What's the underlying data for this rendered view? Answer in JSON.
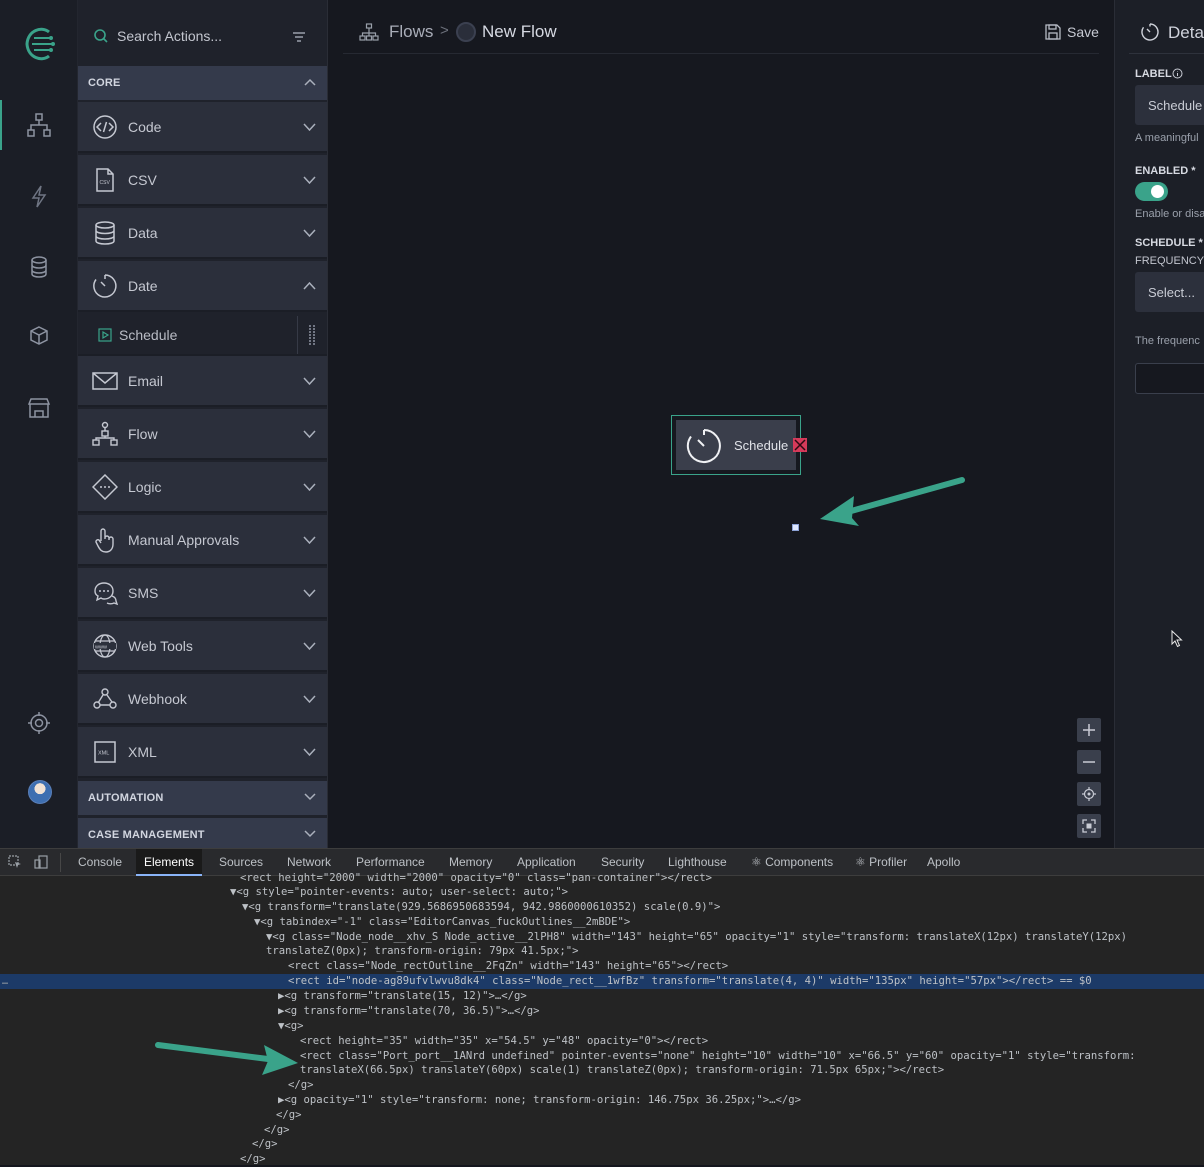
{
  "colors": {
    "accent": "#3aa38a",
    "danger": "#d53a5a",
    "selection": "#1c3a67"
  },
  "sidebar_rail": {
    "icons": [
      "logo-icon",
      "flows-icon",
      "lightning-icon",
      "database-icon",
      "cubes-icon",
      "store-icon",
      "settings-icon",
      "avatar"
    ]
  },
  "actions_panel": {
    "search_placeholder": "Search Actions...",
    "sections": [
      {
        "label": "CORE",
        "expanded": true,
        "items": [
          {
            "label": "Code",
            "icon": "code-icon"
          },
          {
            "label": "CSV",
            "icon": "csv-file-icon"
          },
          {
            "label": "Data",
            "icon": "database-icon"
          },
          {
            "label": "Date",
            "icon": "timer-icon",
            "expanded": true,
            "children": [
              {
                "label": "Schedule",
                "icon": "play-square-icon"
              }
            ]
          },
          {
            "label": "Email",
            "icon": "envelope-icon"
          },
          {
            "label": "Flow",
            "icon": "flow-tree-icon"
          },
          {
            "label": "Logic",
            "icon": "diamond-icon"
          },
          {
            "label": "Manual Approvals",
            "icon": "hand-pointer-icon"
          },
          {
            "label": "SMS",
            "icon": "chat-bubbles-icon"
          },
          {
            "label": "Web Tools",
            "icon": "globe-www-icon"
          },
          {
            "label": "Webhook",
            "icon": "webhook-icon"
          },
          {
            "label": "XML",
            "icon": "xml-file-icon"
          }
        ]
      },
      {
        "label": "AUTOMATION",
        "expanded": false
      },
      {
        "label": "CASE MANAGEMENT",
        "expanded": false
      }
    ]
  },
  "canvas": {
    "breadcrumb": {
      "root": "Flows",
      "separator": ">",
      "current": "New Flow"
    },
    "save_label": "Save",
    "node": {
      "label": "Schedule"
    },
    "zoom_controls": [
      "zoom-in",
      "zoom-out",
      "center",
      "fit"
    ]
  },
  "details": {
    "title": "Detai",
    "label_heading": "LABEL",
    "label_value": "Schedule",
    "label_help": "A meaningful",
    "enabled_heading": "ENABLED *",
    "enabled": true,
    "enabled_help": "Enable or disa",
    "schedule_heading": "SCHEDULE *",
    "frequency_heading": "FREQUENCY",
    "frequency_placeholder": "Select...",
    "frequency_help": "The frequenc"
  },
  "devtools": {
    "tabs": [
      "Console",
      "Elements",
      "Sources",
      "Network",
      "Performance",
      "Memory",
      "Application",
      "Security",
      "Lighthouse",
      "⚛ Components",
      "⚛ Profiler",
      "Apollo"
    ],
    "active_tab": "Elements",
    "lines": [
      "<rect height=\"2000\" width=\"2000\" opacity=\"0\" class=\"pan-container\"></rect>",
      "▼<g style=\"pointer-events: auto; user-select: auto;\">",
      "▼<g transform=\"translate(929.5686950683594, 942.9860000610352) scale(0.9)\">",
      "▼<g tabindex=\"-1\" class=\"EditorCanvas_fuckOutlines__2mBDE\">",
      "▼<g class=\"Node_node__xhv_S Node_active__2lPH8\" width=\"143\" height=\"65\" opacity=\"1\" style=\"transform: translateX(12px) translateY(12px)",
      "translateZ(0px); transform-origin: 79px 41.5px;\">",
      "<rect class=\"Node_rectOutline__2FqZn\" width=\"143\" height=\"65\"></rect>",
      "<rect id=\"node-ag89ufvlwvu8dk4\" class=\"Node_rect__1wfBz\" transform=\"translate(4, 4)\" width=\"135px\" height=\"57px\"></rect> == $0",
      "▶<g transform=\"translate(15, 12)\">…</g>",
      "▶<g transform=\"translate(70, 36.5)\">…</g>",
      "▼<g>",
      "<rect height=\"35\" width=\"35\" x=\"54.5\" y=\"48\" opacity=\"0\"></rect>",
      "<rect class=\"Port_port__1ANrd undefined\" pointer-events=\"none\" height=\"10\" width=\"10\" x=\"66.5\" y=\"60\" opacity=\"1\" style=\"transform:",
      "translateX(66.5px) translateY(60px) scale(1) translateZ(0px); transform-origin: 71.5px 65px;\"></rect>",
      "</g>",
      "▶<g opacity=\"1\" style=\"transform: none; transform-origin: 146.75px 36.25px;\">…</g>",
      "</g>",
      "</g>",
      "</g>",
      "</g>"
    ]
  }
}
